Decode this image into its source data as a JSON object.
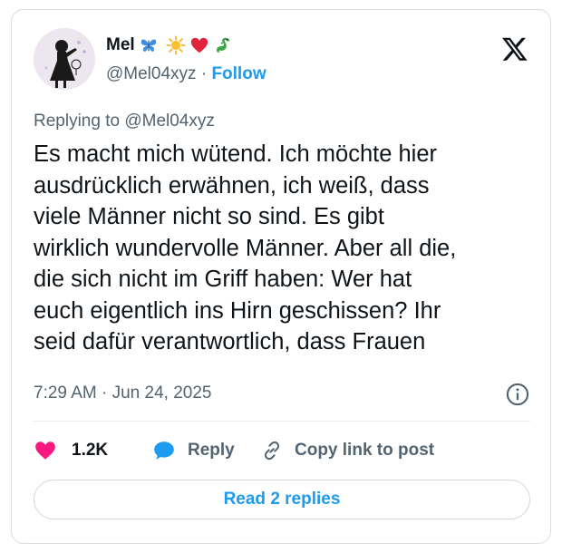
{
  "author": {
    "name": "Mel",
    "handle": "@Mel04xyz",
    "separator": "·",
    "follow_label": "Follow",
    "name_emojis": [
      "butterfly-icon",
      "sun-icon",
      "heart-icon",
      "dragon-icon"
    ]
  },
  "tweet": {
    "replying_to": "Replying to @Mel04xyz",
    "lines": [
      "Es macht mich wütend. Ich möchte hier",
      "ausdrücklich erwähnen, ich weiß, dass",
      "viele Männer nicht so sind. Es gibt",
      "wirklich wundervolle Männer. Aber all die,",
      "die sich nicht im Griff haben: Wer hat",
      "euch eigentlich ins Hirn geschissen? Ihr",
      "seid dafür verantwortlich, dass Frauen"
    ],
    "timestamp": "7:29 AM · Jun 24, 2025"
  },
  "actions": {
    "likes": "1.2K",
    "reply_label": "Reply",
    "copy_label": "Copy link to post"
  },
  "footer": {
    "read_replies": "Read 2 replies"
  },
  "colors": {
    "accent": "#1d9bf0",
    "like": "#f91880",
    "muted": "#536471",
    "text": "#0f1419"
  }
}
